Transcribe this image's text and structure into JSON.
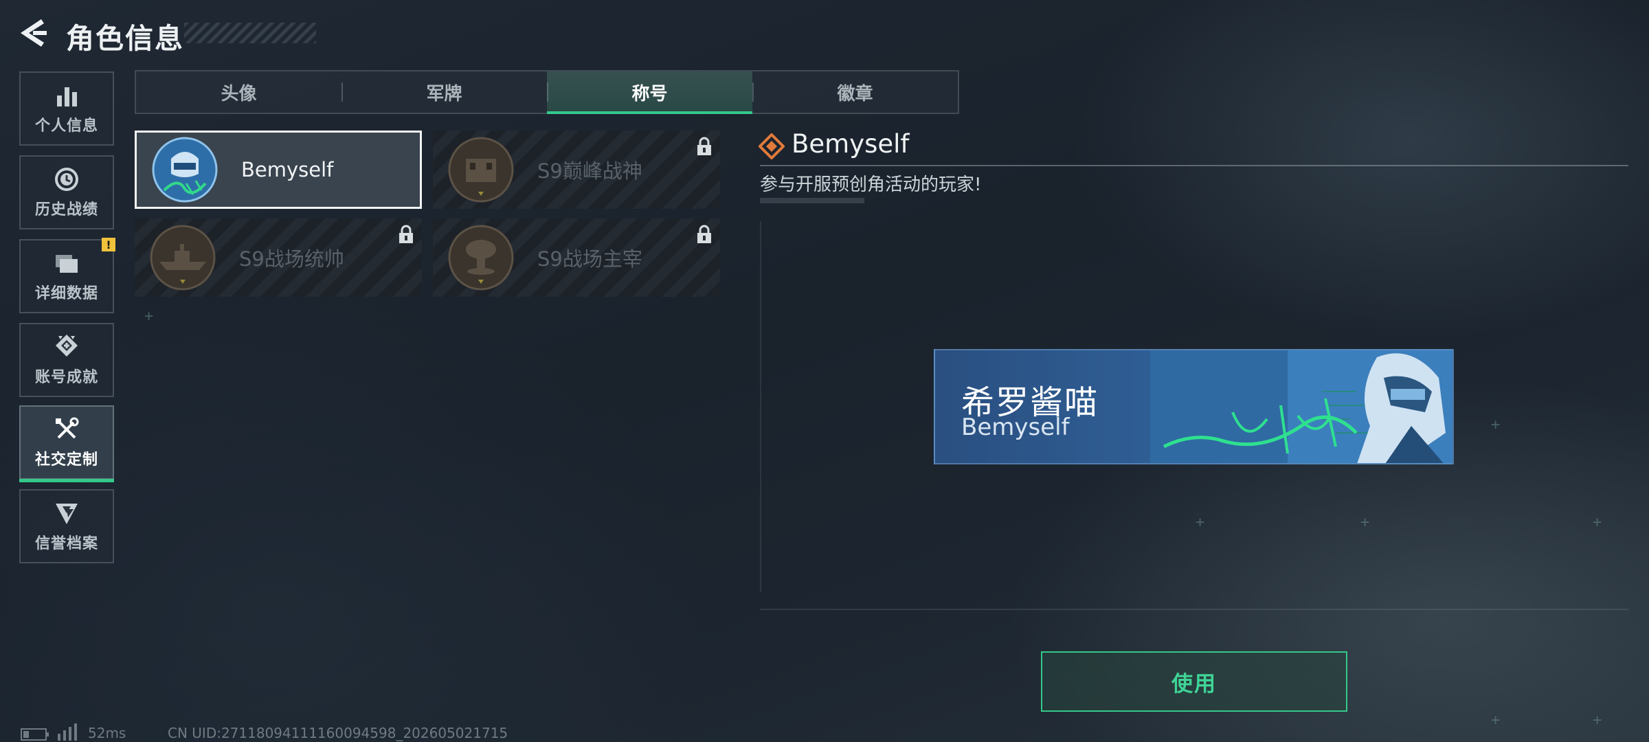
{
  "header": {
    "title": "角色信息"
  },
  "sidebar": {
    "items": [
      {
        "label": "个人信息",
        "icon": "bar-chart-icon"
      },
      {
        "label": "历史战绩",
        "icon": "clock-icon"
      },
      {
        "label": "详细数据",
        "icon": "folder-icon",
        "badge": "!"
      },
      {
        "label": "账号成就",
        "icon": "achievement-icon"
      },
      {
        "label": "社交定制",
        "icon": "wrench-screwdriver-icon",
        "active": true
      },
      {
        "label": "信誉档案",
        "icon": "shield-chevron-icon"
      }
    ]
  },
  "tabs": [
    {
      "label": "头像"
    },
    {
      "label": "军牌"
    },
    {
      "label": "称号",
      "active": true
    },
    {
      "label": "徽章"
    }
  ],
  "titles": [
    {
      "name": "Bemyself",
      "selected": true,
      "locked": false
    },
    {
      "name": "S9巅峰战神",
      "selected": false,
      "locked": true
    },
    {
      "name": "S9战场统帅",
      "selected": false,
      "locked": true
    },
    {
      "name": "S9战场主宰",
      "selected": false,
      "locked": true
    }
  ],
  "detail": {
    "name": "Bemyself",
    "description": "参与开服预创角活动的玩家!"
  },
  "banner": {
    "player_name": "希罗酱喵",
    "title": "Bemyself"
  },
  "actions": {
    "use_label": "使用"
  },
  "status": {
    "latency": "52ms",
    "uid": "CN UID:27118094111160094598_202605021715"
  },
  "colors": {
    "accent_green": "#34c98a",
    "badge_yellow": "#f0c13a",
    "diamond_orange": "#e07a3a",
    "banner_blue": "#2f5f96"
  }
}
